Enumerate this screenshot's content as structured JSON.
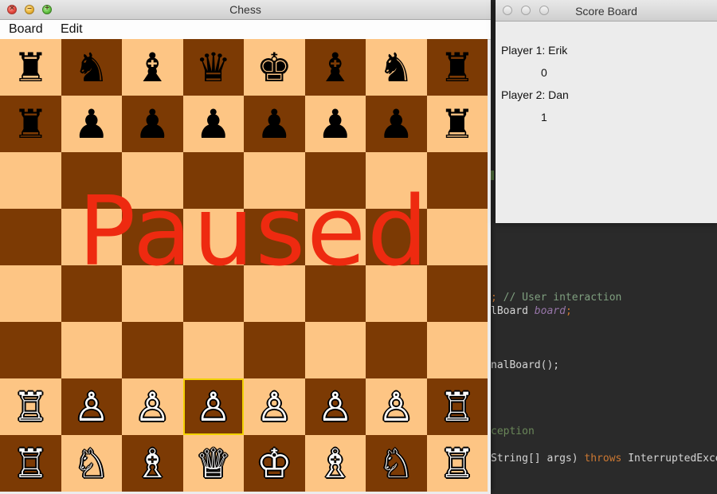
{
  "chess_window": {
    "title": "Chess",
    "menu": [
      "Board",
      "Edit"
    ],
    "overlay_text": "Paused",
    "colors": {
      "light_square": "#fdc584",
      "dark_square": "#7c3a04",
      "overlay": "#ee2a10",
      "selection": "#f2d100"
    },
    "selected_square": {
      "row": 6,
      "col": 3
    },
    "board": [
      [
        {
          "glyph": "♜",
          "color": "black",
          "name": "rook"
        },
        {
          "glyph": "♞",
          "color": "black",
          "name": "knight"
        },
        {
          "glyph": "♝",
          "color": "black",
          "name": "bishop"
        },
        {
          "glyph": "♛",
          "color": "black",
          "name": "queen"
        },
        {
          "glyph": "♚",
          "color": "black",
          "name": "king"
        },
        {
          "glyph": "♝",
          "color": "black",
          "name": "bishop"
        },
        {
          "glyph": "♞",
          "color": "black",
          "name": "knight"
        },
        {
          "glyph": "♜",
          "color": "black",
          "name": "rook"
        }
      ],
      [
        {
          "glyph": "♜",
          "color": "black",
          "name": "rook"
        },
        {
          "glyph": "♟",
          "color": "black",
          "name": "pawn"
        },
        {
          "glyph": "♟",
          "color": "black",
          "name": "pawn"
        },
        {
          "glyph": "♟",
          "color": "black",
          "name": "pawn"
        },
        {
          "glyph": "♟",
          "color": "black",
          "name": "pawn"
        },
        {
          "glyph": "♟",
          "color": "black",
          "name": "pawn"
        },
        {
          "glyph": "♟",
          "color": "black",
          "name": "pawn"
        },
        {
          "glyph": "♜",
          "color": "black",
          "name": "rook"
        }
      ],
      [
        null,
        null,
        null,
        null,
        null,
        null,
        null,
        null
      ],
      [
        null,
        null,
        null,
        null,
        null,
        null,
        null,
        null
      ],
      [
        null,
        null,
        null,
        null,
        null,
        null,
        null,
        null
      ],
      [
        null,
        null,
        null,
        null,
        null,
        null,
        null,
        null
      ],
      [
        {
          "glyph": "♖",
          "color": "white",
          "name": "rook"
        },
        {
          "glyph": "♙",
          "color": "white",
          "name": "pawn"
        },
        {
          "glyph": "♙",
          "color": "white",
          "name": "pawn"
        },
        {
          "glyph": "♙",
          "color": "white",
          "name": "pawn"
        },
        {
          "glyph": "♙",
          "color": "white",
          "name": "pawn"
        },
        {
          "glyph": "♙",
          "color": "white",
          "name": "pawn"
        },
        {
          "glyph": "♙",
          "color": "white",
          "name": "pawn"
        },
        {
          "glyph": "♖",
          "color": "white",
          "name": "rook"
        }
      ],
      [
        {
          "glyph": "♖",
          "color": "white",
          "name": "rook"
        },
        {
          "glyph": "♘",
          "color": "white",
          "name": "knight"
        },
        {
          "glyph": "♗",
          "color": "white",
          "name": "bishop"
        },
        {
          "glyph": "♕",
          "color": "white",
          "name": "queen"
        },
        {
          "glyph": "♔",
          "color": "white",
          "name": "king"
        },
        {
          "glyph": "♗",
          "color": "white",
          "name": "bishop"
        },
        {
          "glyph": "♘",
          "color": "white",
          "name": "knight"
        },
        {
          "glyph": "♖",
          "color": "white",
          "name": "rook"
        }
      ]
    ]
  },
  "score_window": {
    "title": "Score Board",
    "player1_label": "Player 1: Erik",
    "player1_score": "0",
    "player2_label": "Player 2: Dan",
    "player2_score": "1"
  },
  "ide": {
    "lines": [
      {
        "parts": [
          {
            "t": "; ",
            "c": "k"
          },
          {
            "t": "// User interaction",
            "c": "c"
          }
        ]
      },
      {
        "parts": [
          {
            "t": "lBoard ",
            "c": ""
          },
          {
            "t": "board",
            "c": "i"
          },
          {
            "t": ";",
            "c": "k"
          }
        ]
      },
      {
        "parts": [
          {
            "t": "nalBoard();",
            "c": ""
          }
        ]
      },
      {
        "parts": [
          {
            "t": "ception",
            "c": "g"
          }
        ]
      },
      {
        "parts": [
          {
            "t": "String[] args) ",
            "c": ""
          },
          {
            "t": "throws",
            "c": "k"
          },
          {
            "t": " InterruptedExce",
            "c": ""
          }
        ]
      }
    ]
  }
}
